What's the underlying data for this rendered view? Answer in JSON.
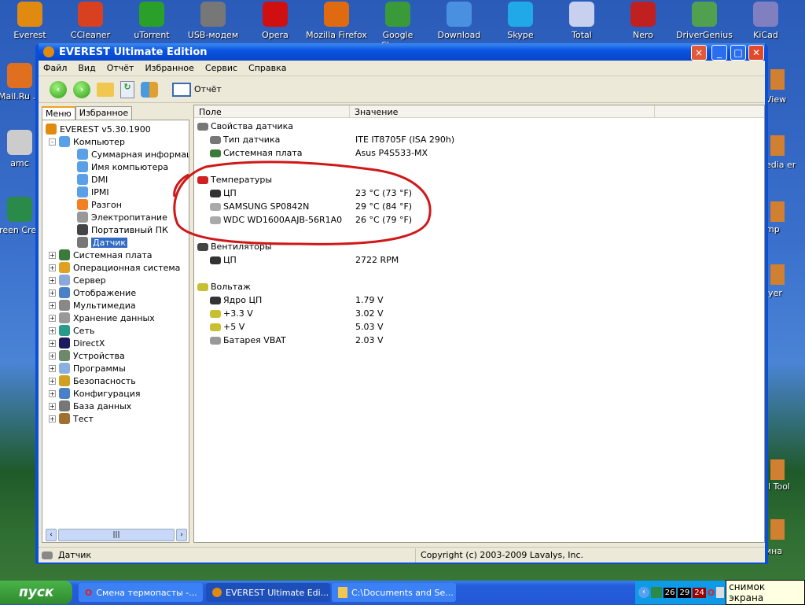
{
  "desktop": {
    "top_icons": [
      {
        "label": "Everest",
        "color": "#e08a10"
      },
      {
        "label": "CCleaner",
        "color": "#d84020"
      },
      {
        "label": "uTorrent",
        "color": "#2aa02a"
      },
      {
        "label": "USB-модем",
        "color": "#777"
      },
      {
        "label": "Opera",
        "color": "#d01010"
      },
      {
        "label": "Mozilla Firefox",
        "color": "#e06a10"
      },
      {
        "label": "Google Chrome",
        "color": "#3a9a3a"
      },
      {
        "label": "Download",
        "color": "#4a90e0"
      },
      {
        "label": "Skype",
        "color": "#20a8e8"
      },
      {
        "label": "Total",
        "color": "#c8d0f0"
      },
      {
        "label": "Nero",
        "color": "#c02020"
      },
      {
        "label": "DriverGenius",
        "color": "#50a050"
      },
      {
        "label": "KiCad",
        "color": "#8080c0"
      }
    ],
    "left_icons": [
      {
        "label": "Mail.Ru ..."
      },
      {
        "label": "amc"
      },
      {
        "label": "Screen Creato"
      }
    ],
    "right_icons": [
      {
        "label": "View"
      },
      {
        "label": "edia er"
      },
      {
        "label": "mp"
      },
      {
        "label": "iyer"
      },
      {
        "label": "ll Tool"
      },
      {
        "label": "ина"
      }
    ]
  },
  "window": {
    "title": "EVEREST Ultimate Edition",
    "menu": [
      "Файл",
      "Вид",
      "Отчёт",
      "Избранное",
      "Сервис",
      "Справка"
    ],
    "toolbar": {
      "report": "Отчёт"
    },
    "tabs": [
      "Меню",
      "Избранное"
    ],
    "tree": [
      {
        "label": "EVEREST v5.30.1900",
        "level": 0,
        "exp": "",
        "color": "#e08a10"
      },
      {
        "label": "Компьютер",
        "level": 1,
        "exp": "-",
        "color": "#5aa0e8"
      },
      {
        "label": "Суммарная информация",
        "level": 2,
        "exp": "",
        "color": "#5aa0e8"
      },
      {
        "label": "Имя компьютера",
        "level": 2,
        "exp": "",
        "color": "#5aa0e8"
      },
      {
        "label": "DMI",
        "level": 2,
        "exp": "",
        "color": "#5aa0e8"
      },
      {
        "label": "IPMI",
        "level": 2,
        "exp": "",
        "color": "#5aa0e8"
      },
      {
        "label": "Разгон",
        "level": 2,
        "exp": "",
        "color": "#f08020"
      },
      {
        "label": "Электропитание",
        "level": 2,
        "exp": "",
        "color": "#999"
      },
      {
        "label": "Портативный ПК",
        "level": 2,
        "exp": "",
        "color": "#444"
      },
      {
        "label": "Датчик",
        "level": 2,
        "exp": "",
        "color": "#777",
        "selected": true
      },
      {
        "label": "Системная плата",
        "level": 1,
        "exp": "+",
        "color": "#3a7a3a"
      },
      {
        "label": "Операционная система",
        "level": 1,
        "exp": "+",
        "color": "#e0a020"
      },
      {
        "label": "Сервер",
        "level": 1,
        "exp": "+",
        "color": "#8aa8d8"
      },
      {
        "label": "Отображение",
        "level": 1,
        "exp": "+",
        "color": "#4a80c8"
      },
      {
        "label": "Мультимедиа",
        "level": 1,
        "exp": "+",
        "color": "#888"
      },
      {
        "label": "Хранение данных",
        "level": 1,
        "exp": "+",
        "color": "#999"
      },
      {
        "label": "Сеть",
        "level": 1,
        "exp": "+",
        "color": "#2a9a8a"
      },
      {
        "label": "DirectX",
        "level": 1,
        "exp": "+",
        "color": "#1a1a60"
      },
      {
        "label": "Устройства",
        "level": 1,
        "exp": "+",
        "color": "#6a8a6a"
      },
      {
        "label": "Программы",
        "level": 1,
        "exp": "+",
        "color": "#8ab0e0"
      },
      {
        "label": "Безопасность",
        "level": 1,
        "exp": "+",
        "color": "#d0a020"
      },
      {
        "label": "Конфигурация",
        "level": 1,
        "exp": "+",
        "color": "#4a80c8"
      },
      {
        "label": "База данных",
        "level": 1,
        "exp": "+",
        "color": "#777"
      },
      {
        "label": "Тест",
        "level": 1,
        "exp": "+",
        "color": "#a07030"
      }
    ],
    "columns": [
      "Поле",
      "Значение"
    ],
    "rows": [
      {
        "field": "Свойства датчика",
        "value": "",
        "group": true,
        "color": "#777"
      },
      {
        "field": "Тип датчика",
        "value": "ITE IT8705F  (ISA 290h)",
        "color": "#777"
      },
      {
        "field": "Системная плата",
        "value": "Asus P4S533-MX",
        "color": "#3a7a3a"
      },
      {
        "field": "",
        "value": ""
      },
      {
        "field": "Температуры",
        "value": "",
        "group": true,
        "color": "#d02020"
      },
      {
        "field": "ЦП",
        "value": "23 °C  (73 °F)",
        "color": "#333"
      },
      {
        "field": "SAMSUNG SP0842N",
        "value": "29 °C  (84 °F)",
        "color": "#aaa"
      },
      {
        "field": "WDC WD1600AAJB-56R1A0",
        "value": "26 °C  (79 °F)",
        "color": "#aaa"
      },
      {
        "field": "",
        "value": ""
      },
      {
        "field": "Вентиляторы",
        "value": "",
        "group": true,
        "color": "#444"
      },
      {
        "field": "ЦП",
        "value": "2722 RPM",
        "color": "#333"
      },
      {
        "field": "",
        "value": ""
      },
      {
        "field": "Вольтаж",
        "value": "",
        "group": true,
        "color": "#c8c030"
      },
      {
        "field": "Ядро ЦП",
        "value": "1.79 V",
        "color": "#333"
      },
      {
        "field": "+3.3 V",
        "value": "3.02 V",
        "color": "#c8c030"
      },
      {
        "field": "+5 V",
        "value": "5.03 V",
        "color": "#c8c030"
      },
      {
        "field": "Батарея VBAT",
        "value": "2.03 V",
        "color": "#999"
      }
    ],
    "status": {
      "left": "Датчик",
      "right": "Copyright (c) 2003-2009 Lavalys, Inc."
    }
  },
  "taskbar": {
    "start": "пуск",
    "items": [
      "Смена термопасты -...",
      "EVEREST Ultimate Edi...",
      "C:\\Documents and Se..."
    ],
    "tray_numbers": [
      "26",
      "29",
      "24"
    ],
    "tooltip": "снимок экрана"
  }
}
